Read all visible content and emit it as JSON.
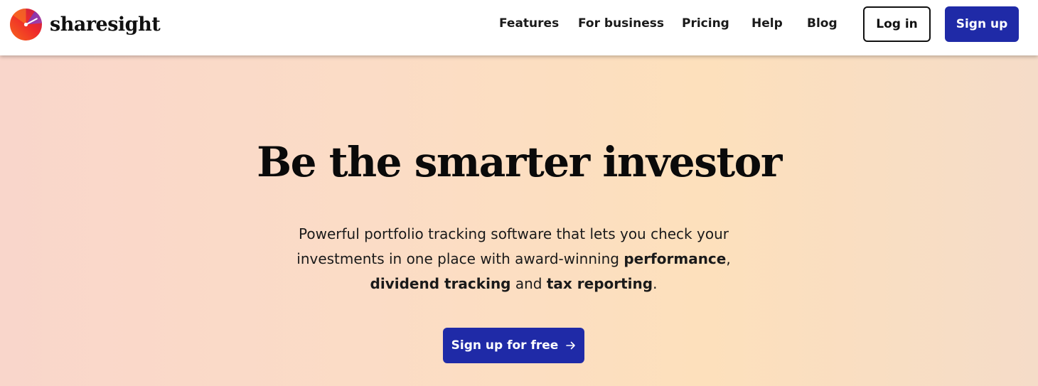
{
  "brand": {
    "name": "sharesight",
    "logo_icon": "sharesight-logo-icon"
  },
  "nav": {
    "links": [
      "Features",
      "For business",
      "Pricing",
      "Help",
      "Blog"
    ],
    "login_label": "Log in",
    "signup_label": "Sign up"
  },
  "hero": {
    "title": "Be the smarter investor",
    "subtitle": {
      "part1": "Powerful portfolio tracking software that lets you check your investments in one place with award-winning ",
      "bold1": "performance",
      "part2": ", ",
      "bold2": "dividend tracking",
      "part3": " and ",
      "bold3": "tax reporting",
      "part4": "."
    },
    "cta_label": "Sign up for free",
    "cta_icon": "arrow-right-icon"
  },
  "colors": {
    "accent": "#1f2aa7",
    "hero_gradient": [
      "#f9d6cb",
      "#fde0bc",
      "#f5dcc8"
    ]
  }
}
